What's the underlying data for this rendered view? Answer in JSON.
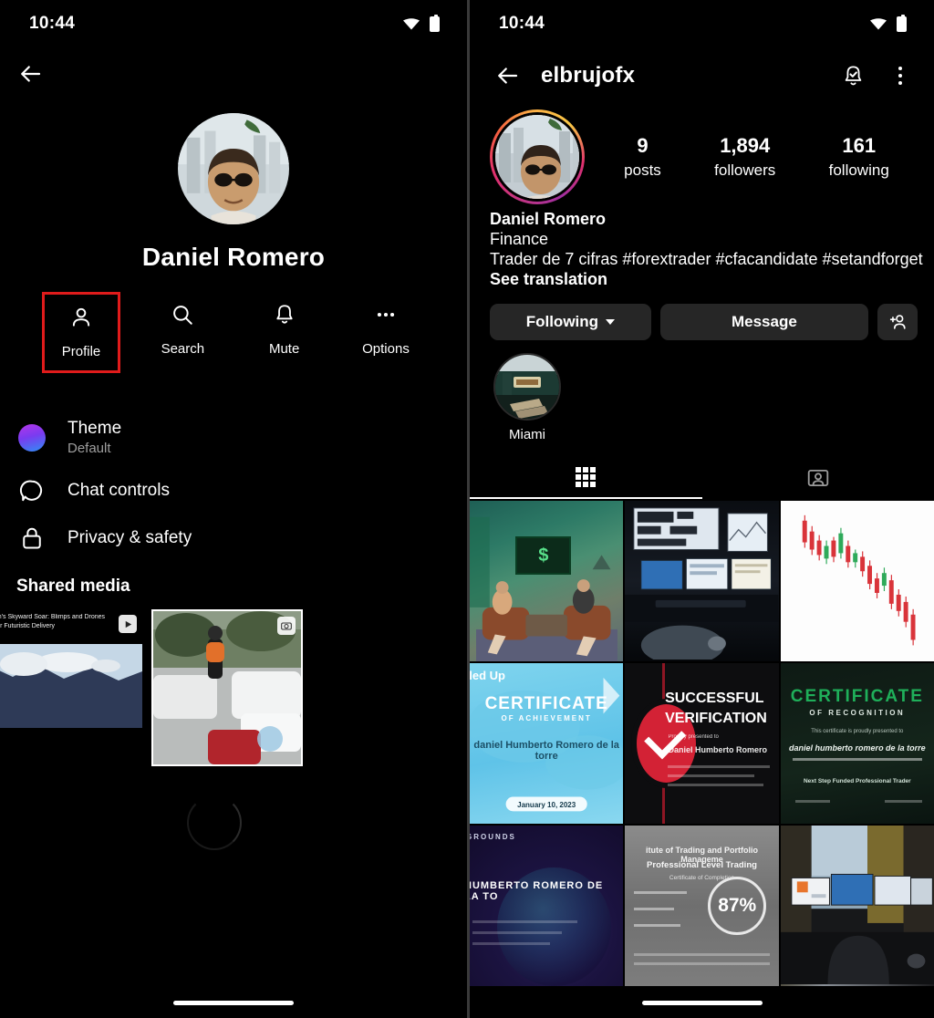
{
  "status_bar": {
    "time": "10:44",
    "wifi_icon": "wifi-icon",
    "battery_icon": "battery-icon"
  },
  "left_panel": {
    "back_icon": "back-arrow-icon",
    "avatar_name": "avatar",
    "name": "Daniel Romero",
    "actions": [
      {
        "label": "Profile",
        "icon": "person-icon",
        "highlighted": true
      },
      {
        "label": "Search",
        "icon": "search-icon",
        "highlighted": false
      },
      {
        "label": "Mute",
        "icon": "bell-icon",
        "highlighted": false
      },
      {
        "label": "Options",
        "icon": "ellipsis-icon",
        "highlighted": false
      }
    ],
    "menu": [
      {
        "title": "Theme",
        "subtitle": "Default",
        "icon": "theme-gradient-icon"
      },
      {
        "title": "Chat controls",
        "subtitle": "",
        "icon": "chat-bubble-icon"
      },
      {
        "title": "Privacy & safety",
        "subtitle": "",
        "icon": "lock-icon"
      }
    ],
    "shared_media_title": "Shared media",
    "shared_media": [
      {
        "caption": "Amazon's Skyward Soar: Blimps and Drones Unite for Futuristic Delivery",
        "badge_icon": "play-icon"
      },
      {
        "caption": "",
        "badge_icon": "camera-icon"
      }
    ],
    "loading_indicator": "spinner"
  },
  "right_panel": {
    "back_icon": "back-arrow-icon",
    "username": "elbrujofx",
    "notification_icon": "bell-check-icon",
    "menu_icon": "vertical-dots-icon",
    "avatar_name": "profile-avatar",
    "stats": [
      {
        "value": "9",
        "label": "posts"
      },
      {
        "value": "1,894",
        "label": "followers"
      },
      {
        "value": "161",
        "label": "following"
      }
    ],
    "bio": {
      "name": "Daniel Romero",
      "category": "Finance",
      "text": "Trader de 7 cifras #forextrader #cfacandidate #setandforget",
      "translate_link": "See translation"
    },
    "buttons": [
      {
        "label": "Following",
        "icon": "chevron-down-icon"
      },
      {
        "label": "Message",
        "icon": ""
      },
      {
        "label": "",
        "icon": "add-person-icon"
      }
    ],
    "highlights": [
      {
        "label": "Miami"
      }
    ],
    "tabs": [
      {
        "icon": "grid-icon",
        "active": true
      },
      {
        "icon": "tagged-person-icon",
        "active": false
      }
    ],
    "posts": [
      {
        "art": "t-podcast",
        "alt": "podcast-interview-thumbnail"
      },
      {
        "art": "t-desk",
        "alt": "trading-desk-monitors-thumbnail"
      },
      {
        "art": "t-chart",
        "alt": "candlestick-chart-thumbnail"
      },
      {
        "art": "t-cert-blue",
        "alt": "certificate-of-achievement-thumbnail",
        "line1": "CERTIFICATE",
        "line2": "OF ACHIEVEMENT",
        "line3": "daniel Humberto Romero de la torre",
        "line4": "January 10, 2023",
        "brand": "eled Up"
      },
      {
        "art": "t-cert-black",
        "alt": "successful-verification-thumbnail",
        "line1": "SUCCESSFUL",
        "line2": "VERIFICATION",
        "line3": "Proudly presented to",
        "line4": "Daniel Humberto Romero"
      },
      {
        "art": "t-cert-green",
        "alt": "certificate-of-recognition-thumbnail",
        "line1": "CERTIFICATE",
        "line2": "OF RECOGNITION",
        "line3": "This certificate is proudly presented to",
        "line4": "daniel humberto romero de la torre",
        "line5": "Next Step Funded Professional Trader"
      },
      {
        "art": "t-cert-purple",
        "alt": "funded-challenge-certificate-thumbnail",
        "line1": "HUMBERTO ROMERO DE LA TO",
        "line2": "GROUNDS"
      },
      {
        "art": "t-cert-gray",
        "alt": "trading-course-completion-thumbnail",
        "line1": "itute of Trading and Portfolio Manageme",
        "line2": "Professional Level Trading",
        "line3": "Certificate of Completion",
        "pct": "87%"
      },
      {
        "art": "t-office",
        "alt": "home-office-setup-thumbnail"
      }
    ]
  }
}
